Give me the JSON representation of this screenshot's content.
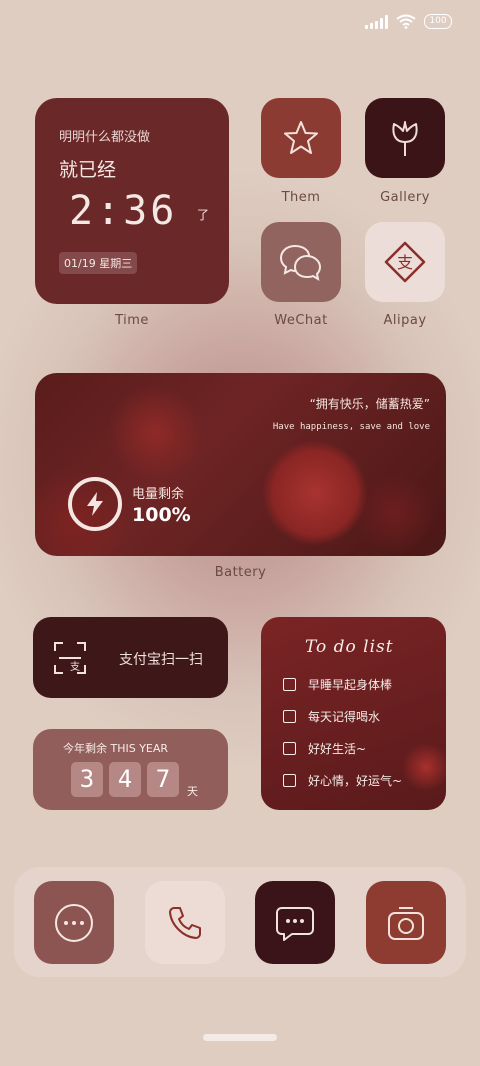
{
  "status": {
    "battery": "100"
  },
  "time_widget": {
    "line1": "明明什么都没做",
    "line2": "就已经",
    "clock": "2:36",
    "suffix": "了",
    "date": "01/19  星期三",
    "label": "Time"
  },
  "apps": [
    {
      "name": "Them",
      "icon": "star-icon",
      "color": "#8b3b32"
    },
    {
      "name": "Gallery",
      "icon": "tulip-icon",
      "color": "#3b1418"
    },
    {
      "name": "WeChat",
      "icon": "chat-bubbles-icon",
      "color": "#916460"
    },
    {
      "name": "Alipay",
      "icon": "alipay-icon",
      "color": "#ecddd8"
    }
  ],
  "battery_widget": {
    "quote_cn": "“拥有快乐，储蓄热爱”",
    "quote_en": "Have happiness, save and love",
    "label_cn": "电量剩余",
    "value": "100%",
    "label": "Battery"
  },
  "scan_widget": {
    "text": "支付宝扫一扫"
  },
  "year_widget": {
    "header": "今年剩余   THIS YEAR",
    "digits": [
      "3",
      "4",
      "7"
    ],
    "unit": "天"
  },
  "todo_widget": {
    "title": "To do list",
    "items": [
      "早睡早起身体棒",
      "每天记得喝水",
      "好好生活~",
      "好心情，好运气~"
    ]
  },
  "dock": [
    {
      "icon": "more-icon",
      "color": "#8d5552"
    },
    {
      "icon": "phone-icon",
      "color": "#ecdcd5"
    },
    {
      "icon": "message-icon",
      "color": "#3a1418"
    },
    {
      "icon": "camera-icon",
      "color": "#8e3c31"
    }
  ]
}
